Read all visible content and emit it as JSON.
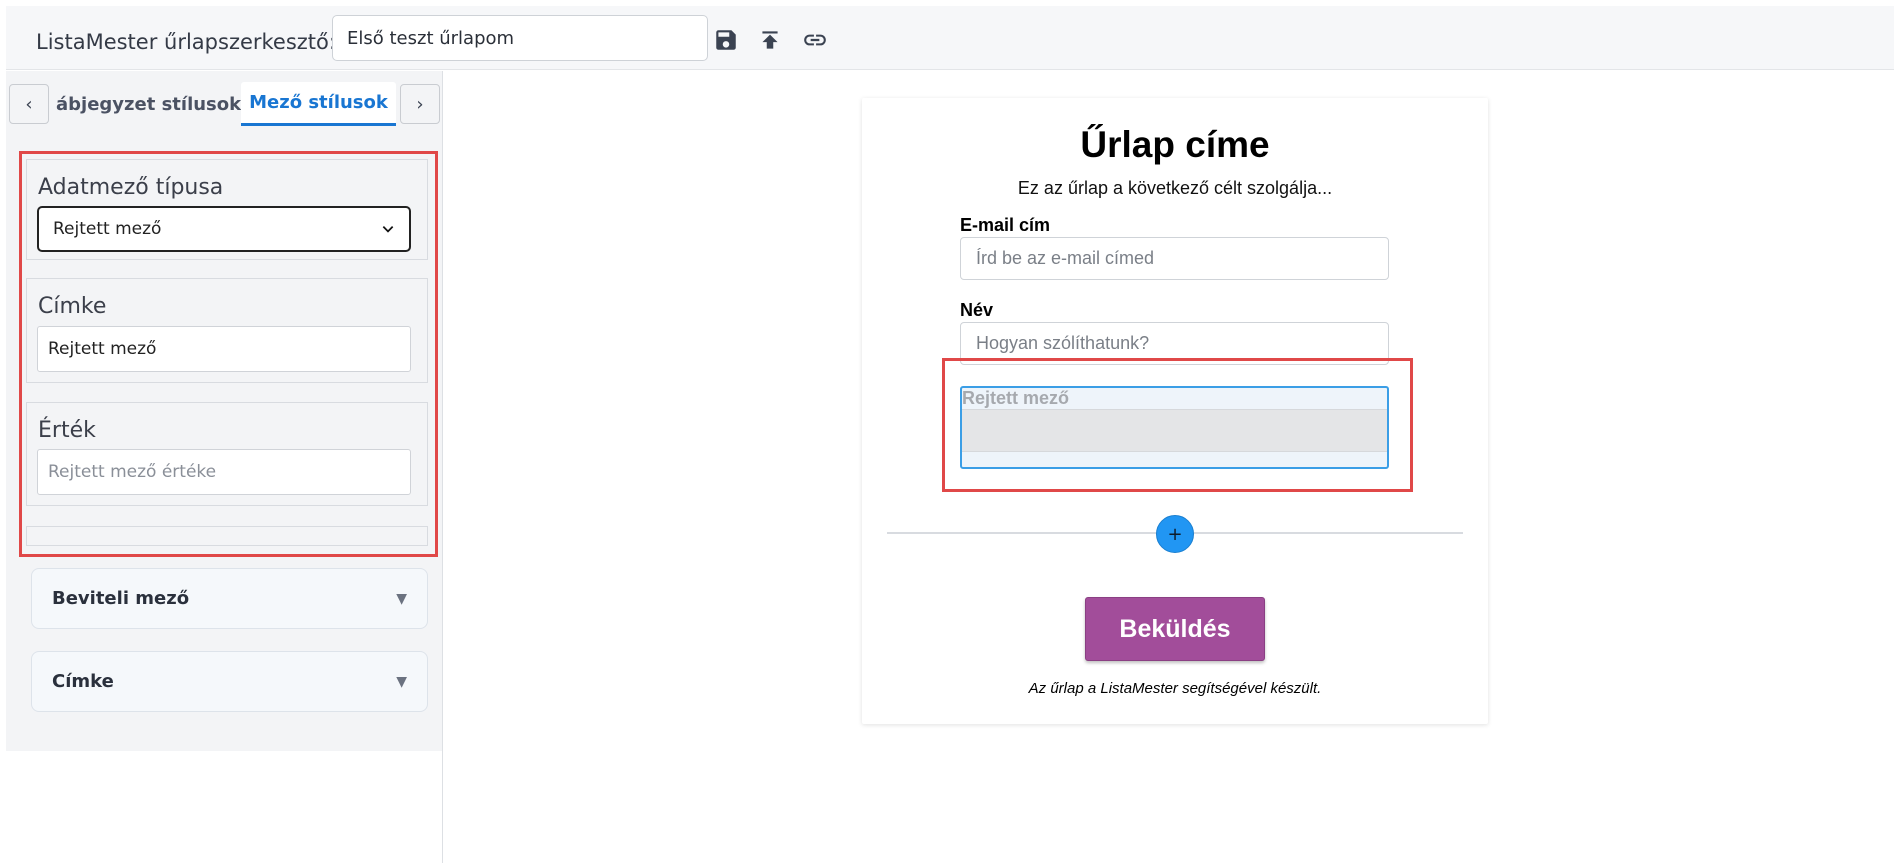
{
  "header": {
    "app_title": "ListaMester űrlapszerkesztő:",
    "form_name": "Első teszt űrlapom",
    "icons": [
      "save-icon",
      "upload-icon",
      "link-icon"
    ]
  },
  "sidebar": {
    "prev_label": "‹",
    "next_label": "›",
    "tabs": [
      {
        "label": "ábjegyzet stílusok",
        "active": false
      },
      {
        "label": "Mező stílusok",
        "active": true
      }
    ],
    "field_type": {
      "label": "Adatmező típusa",
      "value": "Rejtett mező"
    },
    "field_label": {
      "label": "Címke",
      "value": "Rejtett mező"
    },
    "field_value": {
      "label": "Érték",
      "placeholder": "Rejtett mező értéke"
    },
    "accordions": [
      {
        "label": "Beviteli mező",
        "arrow": "▼"
      },
      {
        "label": "Címke",
        "arrow": "▼"
      }
    ]
  },
  "form": {
    "title": "Űrlap címe",
    "subtitle": "Ez az űrlap a következő célt szolgálja...",
    "fields": [
      {
        "label": "E-mail cím",
        "placeholder": "Írd be az e-mail címed"
      },
      {
        "label": "Név",
        "placeholder": "Hogyan szólíthatunk?"
      }
    ],
    "hidden_field": {
      "label": "Rejtett mező"
    },
    "add_label": "+",
    "submit_label": "Beküldés",
    "credit": "Az űrlap a ListaMester segítségével készült."
  },
  "colors": {
    "accent": "#1976d2",
    "add_button": "#2196f3",
    "submit": "#a24d9a",
    "highlight": "#e04848"
  }
}
